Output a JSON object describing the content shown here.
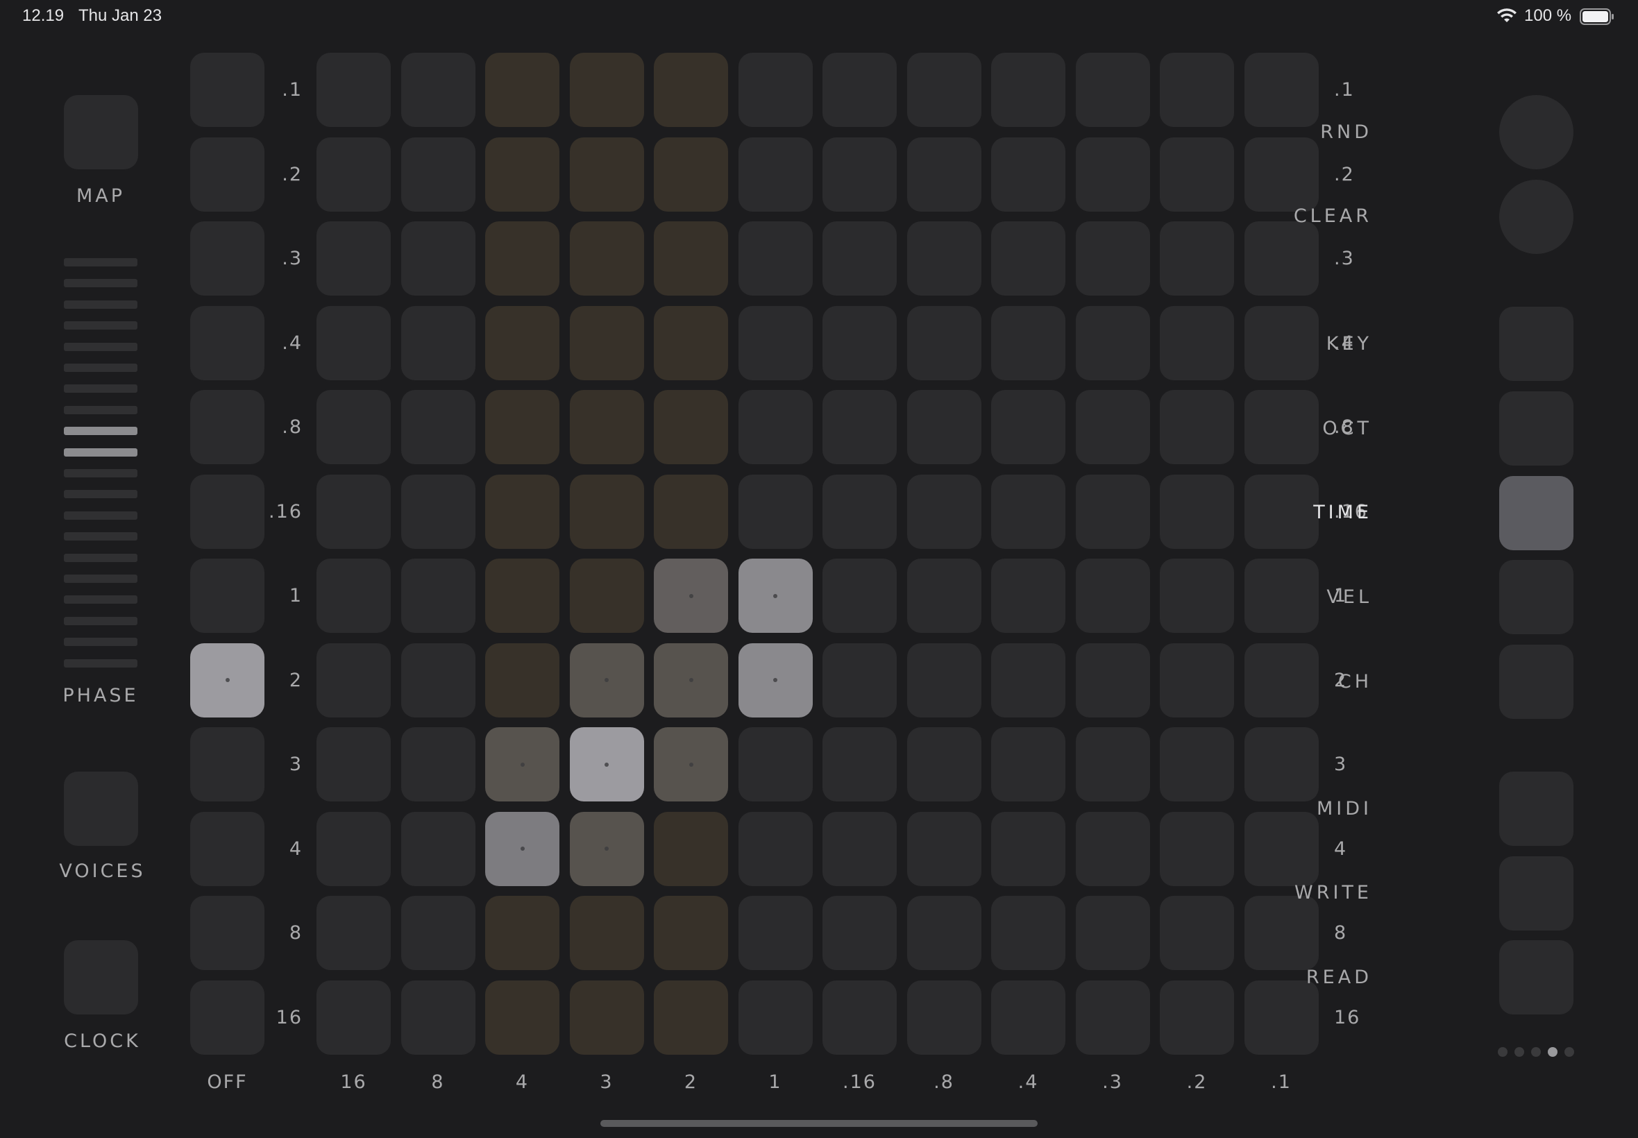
{
  "status_bar": {
    "time": "12.19",
    "date": "Thu Jan 23",
    "battery": "100 %",
    "wifi_icon": "wifi-icon",
    "battery_icon": "battery-icon"
  },
  "left_panel": {
    "map_label": "MAP",
    "phase_label": "PHASE",
    "voices_label": "VOICES",
    "clock_label": "CLOCK",
    "phase_bar_count": 20,
    "phase_lit": [
      9,
      10
    ]
  },
  "row_labels_left": [
    ".1",
    ".2",
    ".3",
    ".4",
    ".8",
    ".16",
    "1",
    "2",
    "3",
    "4",
    "8",
    "16"
  ],
  "row_labels_right": [
    ".1",
    ".2",
    ".3",
    ".4",
    ".8",
    ".16",
    "1",
    "2",
    "3",
    "4",
    "8",
    "16"
  ],
  "col_labels": [
    "OFF",
    "16",
    "8",
    "4",
    "3",
    "2",
    "1",
    ".16",
    ".8",
    ".4",
    ".3",
    ".2",
    ".1"
  ],
  "grid": {
    "rows": 12,
    "cols": 12,
    "tinted_cols": [
      2,
      3,
      4
    ],
    "lit": [
      {
        "row": 6,
        "col": 4,
        "level": 1
      },
      {
        "row": 6,
        "col": 5,
        "level": 3
      },
      {
        "row": 7,
        "col": 3,
        "level": 2
      },
      {
        "row": 7,
        "col": 4,
        "level": 2
      },
      {
        "row": 7,
        "col": 5,
        "level": 3
      },
      {
        "row": 8,
        "col": 2,
        "level": 2
      },
      {
        "row": 8,
        "col": 3,
        "level": 5
      },
      {
        "row": 8,
        "col": 4,
        "level": 2
      },
      {
        "row": 9,
        "col": 2,
        "level": 4
      },
      {
        "row": 9,
        "col": 3,
        "level": 2
      }
    ],
    "off_column_lit_row": 7
  },
  "right_panel": {
    "rnd": "RND",
    "clear": "CLEAR",
    "key": "KEY",
    "oct": "OCT",
    "time": "TIME",
    "vel": "VEL",
    "ch": "CH",
    "midi": "MIDI",
    "write": "WRITE",
    "read": "READ",
    "active": "TIME"
  },
  "page_indicator": {
    "count": 5,
    "current": 4
  },
  "colors": {
    "background": "#1c1c1e",
    "pad": "#2b2b2d",
    "tint": "#373129",
    "lit": "#8a898d"
  }
}
